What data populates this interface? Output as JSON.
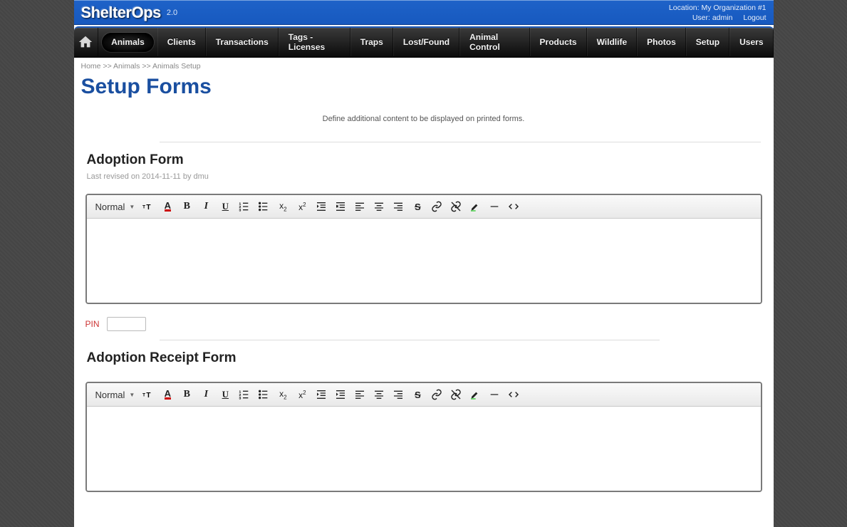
{
  "header": {
    "logo_text": "ShelterOps",
    "version": "2.0",
    "location_label": "Location: My Organization #1",
    "user_label": "User: admin",
    "logout_label": "Logout"
  },
  "nav": {
    "items": [
      {
        "label": "Animals",
        "active": true
      },
      {
        "label": "Clients"
      },
      {
        "label": "Transactions"
      },
      {
        "label": "Tags - Licenses"
      },
      {
        "label": "Traps"
      },
      {
        "label": "Lost/Found"
      },
      {
        "label": "Animal Control"
      },
      {
        "label": "Products"
      },
      {
        "label": "Wildlife"
      },
      {
        "label": "Photos"
      },
      {
        "label": "Setup"
      },
      {
        "label": "Users"
      }
    ]
  },
  "breadcrumb": {
    "home": "Home",
    "sep": ">>",
    "animals": "Animals",
    "setup": "Animals Setup"
  },
  "page": {
    "title": "Setup Forms",
    "description": "Define additional content to be displayed on printed forms."
  },
  "forms": {
    "adoption": {
      "title": "Adoption Form",
      "meta": "Last revised on 2014-11-11 by dmu"
    },
    "receipt": {
      "title": "Adoption Receipt Form"
    }
  },
  "pin": {
    "label": "PIN",
    "value": ""
  },
  "toolbar": {
    "format_label": "Normal"
  }
}
